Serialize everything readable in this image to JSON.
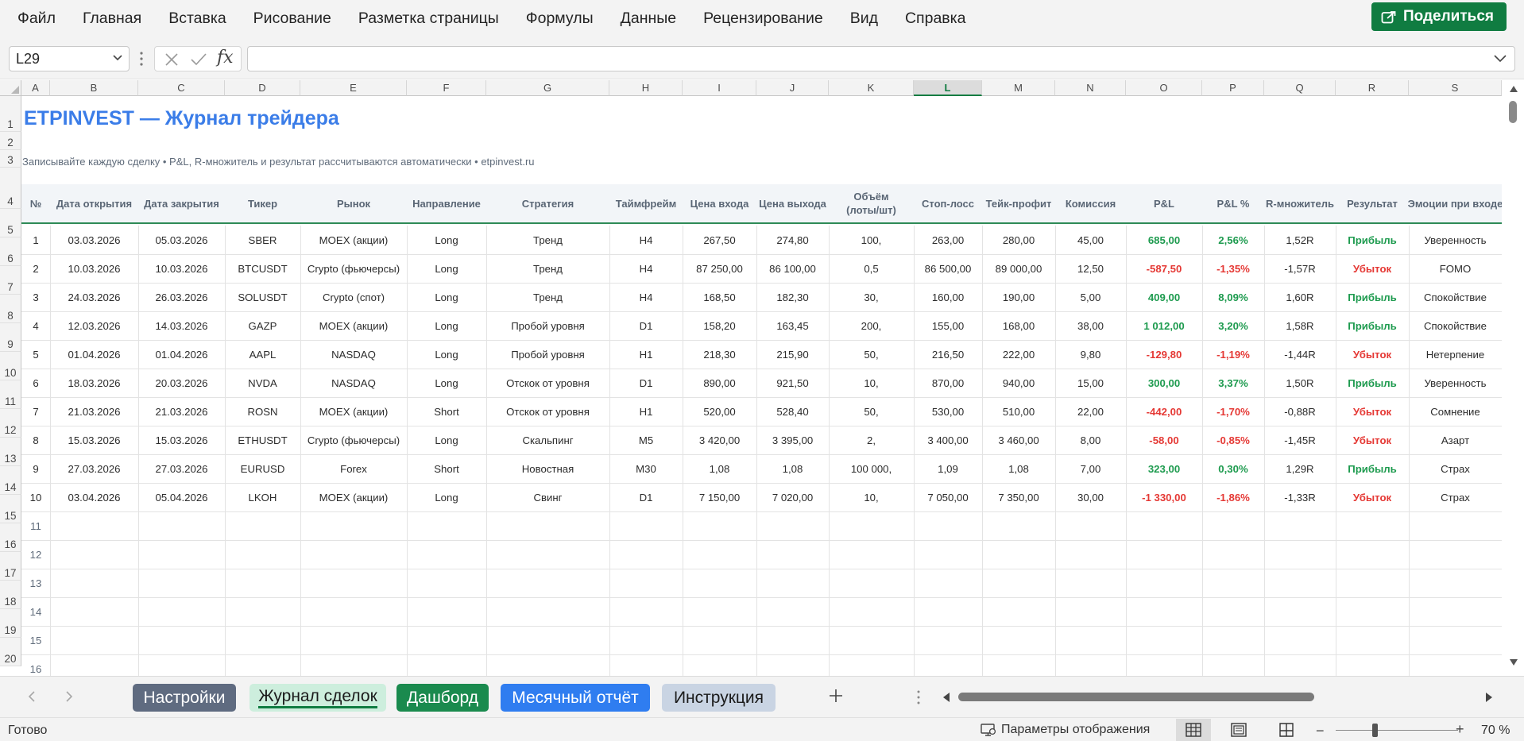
{
  "menu": [
    "Файл",
    "Главная",
    "Вставка",
    "Рисование",
    "Разметка страницы",
    "Формулы",
    "Данные",
    "Рецензирование",
    "Вид",
    "Справка"
  ],
  "share_label": "Поделиться",
  "namebox": "L29",
  "fx_label": "fx",
  "columns": [
    "A",
    "B",
    "C",
    "D",
    "E",
    "F",
    "G",
    "H",
    "I",
    "J",
    "K",
    "L",
    "M",
    "N",
    "O",
    "P",
    "Q",
    "R",
    "S"
  ],
  "selected_column": "L",
  "row_numbers": [
    "1",
    "2",
    "3",
    "4",
    "5",
    "6",
    "7",
    "8",
    "9",
    "10",
    "11",
    "12",
    "13",
    "14",
    "15",
    "16",
    "17",
    "18",
    "19",
    "20"
  ],
  "sheet_title": "ETPINVEST — Журнал трейдера",
  "sheet_subtitle": "Записывайте каждую сделку  •  P&L, R-множитель и результат рассчитываются автоматически  •  etpinvest.ru",
  "headers": [
    "№",
    "Дата открытия",
    "Дата закрытия",
    "Тикер",
    "Рынок",
    "Направление",
    "Стратегия",
    "Таймфрейм",
    "Цена входа",
    "Цена выхода",
    "Объём\n(лоты/шт)",
    "Стоп-лосс",
    "Тейк-профит",
    "Комиссия",
    "P&L",
    "P&L %",
    "R-множитель",
    "Результат",
    "Эмоции при входе"
  ],
  "trades": [
    [
      "1",
      "03.03.2026",
      "05.03.2026",
      "SBER",
      "MOEX (акции)",
      "Long",
      "Тренд",
      "H4",
      "267,50",
      "274,80",
      "100,",
      "263,00",
      "280,00",
      "45,00",
      "685,00",
      "2,56%",
      "1,52R",
      "Прибыль",
      "Уверенность"
    ],
    [
      "2",
      "10.03.2026",
      "10.03.2026",
      "BTCUSDT",
      "Crypto (фьючерсы)",
      "Long",
      "Тренд",
      "H4",
      "87 250,00",
      "86 100,00",
      "0,5",
      "86 500,00",
      "89 000,00",
      "12,50",
      "-587,50",
      "-1,35%",
      "-1,57R",
      "Убыток",
      "FOMO"
    ],
    [
      "3",
      "24.03.2026",
      "26.03.2026",
      "SOLUSDT",
      "Crypto (спот)",
      "Long",
      "Тренд",
      "H4",
      "168,50",
      "182,30",
      "30,",
      "160,00",
      "190,00",
      "5,00",
      "409,00",
      "8,09%",
      "1,60R",
      "Прибыль",
      "Спокойствие"
    ],
    [
      "4",
      "12.03.2026",
      "14.03.2026",
      "GAZP",
      "MOEX (акции)",
      "Long",
      "Пробой уровня",
      "D1",
      "158,20",
      "163,45",
      "200,",
      "155,00",
      "168,00",
      "38,00",
      "1 012,00",
      "3,20%",
      "1,58R",
      "Прибыль",
      "Спокойствие"
    ],
    [
      "5",
      "01.04.2026",
      "01.04.2026",
      "AAPL",
      "NASDAQ",
      "Long",
      "Пробой уровня",
      "H1",
      "218,30",
      "215,90",
      "50,",
      "216,50",
      "222,00",
      "9,80",
      "-129,80",
      "-1,19%",
      "-1,44R",
      "Убыток",
      "Нетерпение"
    ],
    [
      "6",
      "18.03.2026",
      "20.03.2026",
      "NVDA",
      "NASDAQ",
      "Long",
      "Отскок от уровня",
      "D1",
      "890,00",
      "921,50",
      "10,",
      "870,00",
      "940,00",
      "15,00",
      "300,00",
      "3,37%",
      "1,50R",
      "Прибыль",
      "Уверенность"
    ],
    [
      "7",
      "21.03.2026",
      "21.03.2026",
      "ROSN",
      "MOEX (акции)",
      "Short",
      "Отскок от уровня",
      "H1",
      "520,00",
      "528,40",
      "50,",
      "530,00",
      "510,00",
      "22,00",
      "-442,00",
      "-1,70%",
      "-0,88R",
      "Убыток",
      "Сомнение"
    ],
    [
      "8",
      "15.03.2026",
      "15.03.2026",
      "ETHUSDT",
      "Crypto (фьючерсы)",
      "Long",
      "Скальпинг",
      "M5",
      "3 420,00",
      "3 395,00",
      "2,",
      "3 400,00",
      "3 460,00",
      "8,00",
      "-58,00",
      "-0,85%",
      "-1,45R",
      "Убыток",
      "Азарт"
    ],
    [
      "9",
      "27.03.2026",
      "27.03.2026",
      "EURUSD",
      "Forex",
      "Short",
      "Новостная",
      "M30",
      "1,08",
      "1,08",
      "100 000,",
      "1,09",
      "1,08",
      "7,00",
      "323,00",
      "0,30%",
      "1,29R",
      "Прибыль",
      "Страх"
    ],
    [
      "10",
      "03.04.2026",
      "05.04.2026",
      "LKOH",
      "MOEX (акции)",
      "Long",
      "Свинг",
      "D1",
      "7 150,00",
      "7 020,00",
      "10,",
      "7 050,00",
      "7 350,00",
      "30,00",
      "-1 330,00",
      "-1,86%",
      "-1,33R",
      "Убыток",
      "Страх"
    ]
  ],
  "empty_numbers": [
    "11",
    "12",
    "13",
    "14",
    "15",
    "16"
  ],
  "sheet_tabs": [
    {
      "label": "Настройки",
      "bg": "#5f6b80",
      "color": "#ffffff"
    },
    {
      "label": "Журнал сделок",
      "bg": "#cdeedd",
      "color": "#1b1b1b",
      "active": true
    },
    {
      "label": "Дашборд",
      "bg": "#1a8a4e",
      "color": "#ffffff"
    },
    {
      "label": "Месячный отчёт",
      "bg": "#2f7df0",
      "color": "#ffffff"
    },
    {
      "label": "Инструкция",
      "bg": "#c9d4e3",
      "color": "#1b1b1b"
    }
  ],
  "status_ready": "Готово",
  "display_settings": "Параметры отображения",
  "zoom_level": "70 %",
  "colors": {
    "accent": "#107c41",
    "profit": "#1e9b4f",
    "loss": "#e53935",
    "title": "#3b7de8"
  }
}
